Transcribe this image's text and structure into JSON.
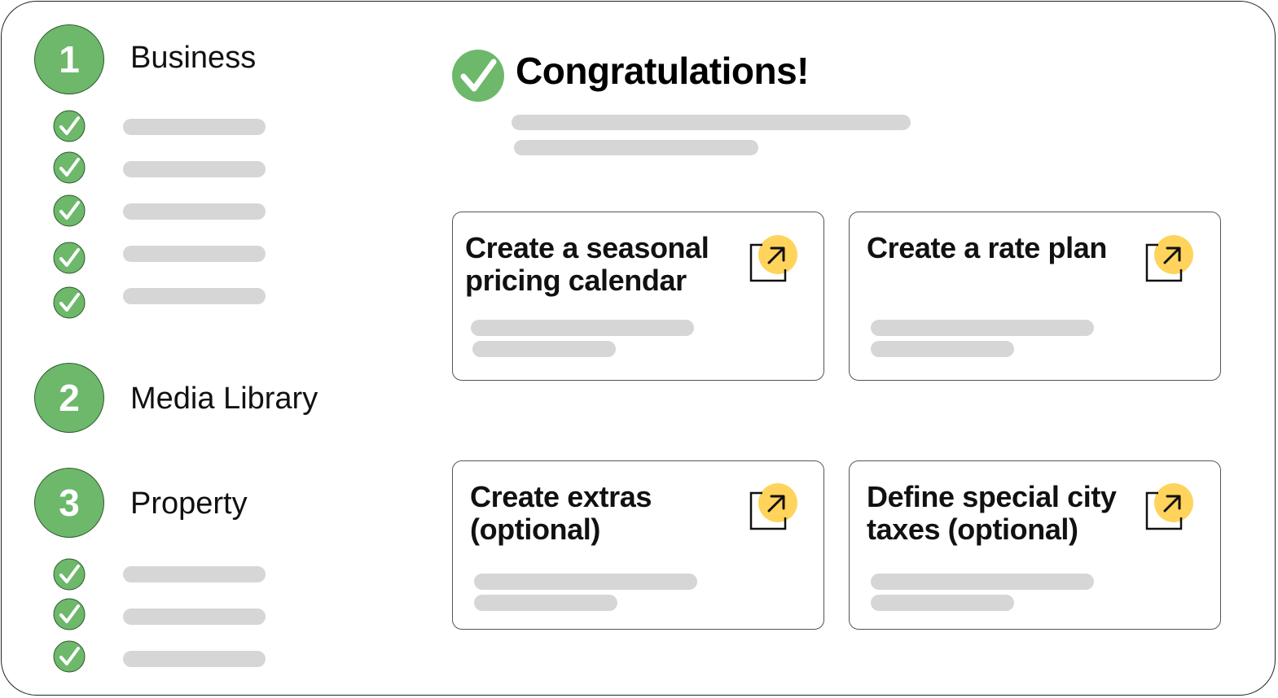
{
  "steps": [
    {
      "number": "1",
      "label": "Business"
    },
    {
      "number": "2",
      "label": "Media Library"
    },
    {
      "number": "3",
      "label": "Property"
    }
  ],
  "header": {
    "title": "Congratulations!"
  },
  "cards": [
    {
      "title": "Create a seasonal\npricing calendar",
      "icon": "external-link-icon"
    },
    {
      "title": "Create a rate plan",
      "icon": "external-link-icon"
    },
    {
      "title": "Create extras\n(optional)",
      "icon": "external-link-icon"
    },
    {
      "title": "Define special city\ntaxes (optional)",
      "icon": "external-link-icon"
    }
  ],
  "colors": {
    "step_green": "#6db86b",
    "check_green": "#6db86b",
    "icon_accent": "#ffd35c",
    "skeleton_gray": "#d6d6d6"
  }
}
